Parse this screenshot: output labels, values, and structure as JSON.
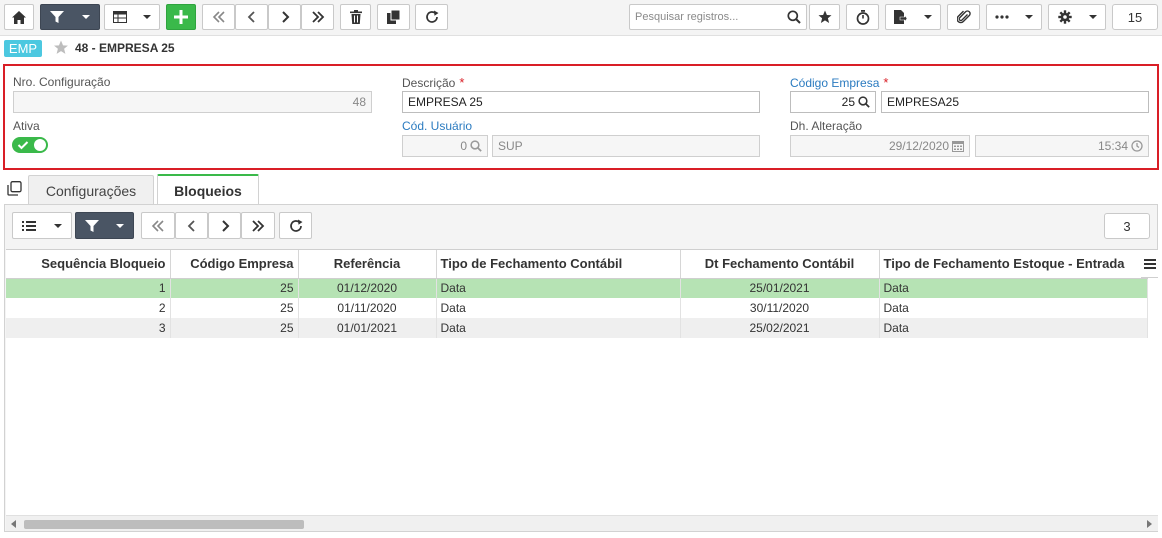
{
  "toolbar": {
    "search_placeholder": "Pesquisar registros...",
    "record_count": "15"
  },
  "breadcrumb": {
    "badge": "EMP",
    "title": "48 - EMPRESA 25"
  },
  "form": {
    "nro_config": {
      "label": "Nro. Configuração",
      "value": "48"
    },
    "descricao": {
      "label": "Descrição",
      "required": "*",
      "value": "EMPRESA 25"
    },
    "codigo_empresa": {
      "label": "Código Empresa",
      "required": "*",
      "code": "25",
      "name": "EMPRESA25"
    },
    "ativa": {
      "label": "Ativa"
    },
    "cod_usuario": {
      "label": "Cód. Usuário",
      "code": "0",
      "name": "SUP"
    },
    "dh_alteracao": {
      "label": "Dh. Alteração",
      "date": "29/12/2020",
      "time": "15:34"
    }
  },
  "tabs": [
    {
      "label": "Configurações"
    },
    {
      "label": "Bloqueios"
    }
  ],
  "grid": {
    "record_count": "3",
    "columns": [
      "Sequência Bloqueio",
      "Código Empresa",
      "Referência",
      "Tipo de Fechamento Contábil",
      "Dt Fechamento Contábil",
      "Tipo de Fechamento Estoque - Entrada"
    ],
    "rows": [
      {
        "seq": "1",
        "empresa": "25",
        "referencia": "01/12/2020",
        "tipo_contabil": "Data",
        "dt_contabil": "25/01/2021",
        "tipo_estoque": "Data"
      },
      {
        "seq": "2",
        "empresa": "25",
        "referencia": "01/11/2020",
        "tipo_contabil": "Data",
        "dt_contabil": "30/11/2020",
        "tipo_estoque": "Data"
      },
      {
        "seq": "3",
        "empresa": "25",
        "referencia": "01/01/2021",
        "tipo_contabil": "Data",
        "dt_contabil": "25/02/2021",
        "tipo_estoque": "Data"
      }
    ]
  },
  "colors": {
    "accent_green": "#3ab94a",
    "toolbar_dark": "#4a5564",
    "required_red": "#d91e26",
    "label_blue": "#2b7bc0",
    "badge_cyan": "#4cc8e0",
    "selected_row": "#b6e3b4"
  }
}
